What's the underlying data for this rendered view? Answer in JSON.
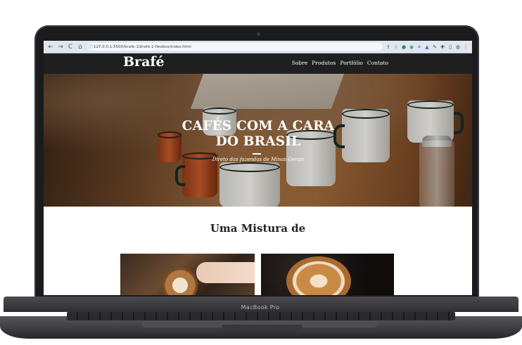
{
  "device": {
    "model_label": "MacBook Pro"
  },
  "browser": {
    "nav": {
      "back": "←",
      "forward": "→",
      "reload": "C",
      "home": "⌂"
    },
    "address": {
      "info_icon": "ⓘ",
      "url": "127.0.0.1:5500/brafe-1/brafe-1-flexbox/index.html"
    },
    "toolbar_icons": [
      "share-icon",
      "star-icon",
      "extension-icon",
      "extension-icon",
      "extension-icon",
      "extension-icon",
      "pen-icon",
      "puzzle-icon",
      "sidebar-icon",
      "profile-icon",
      "menu-icon"
    ]
  },
  "site": {
    "brand": "Brafé",
    "menu": [
      "Sobre",
      "Produtos",
      "Portfólio",
      "Contato"
    ],
    "hero": {
      "title": "CAFÉS COM A CARA DO BRASIL",
      "subtitle": "Direto das fazendas de Minas Gerais"
    },
    "section_title": "Uma Mistura de"
  },
  "colors": {
    "nav_bg": "#1f1f1f",
    "hero_text": "#ffffff",
    "section_text": "#222222"
  }
}
